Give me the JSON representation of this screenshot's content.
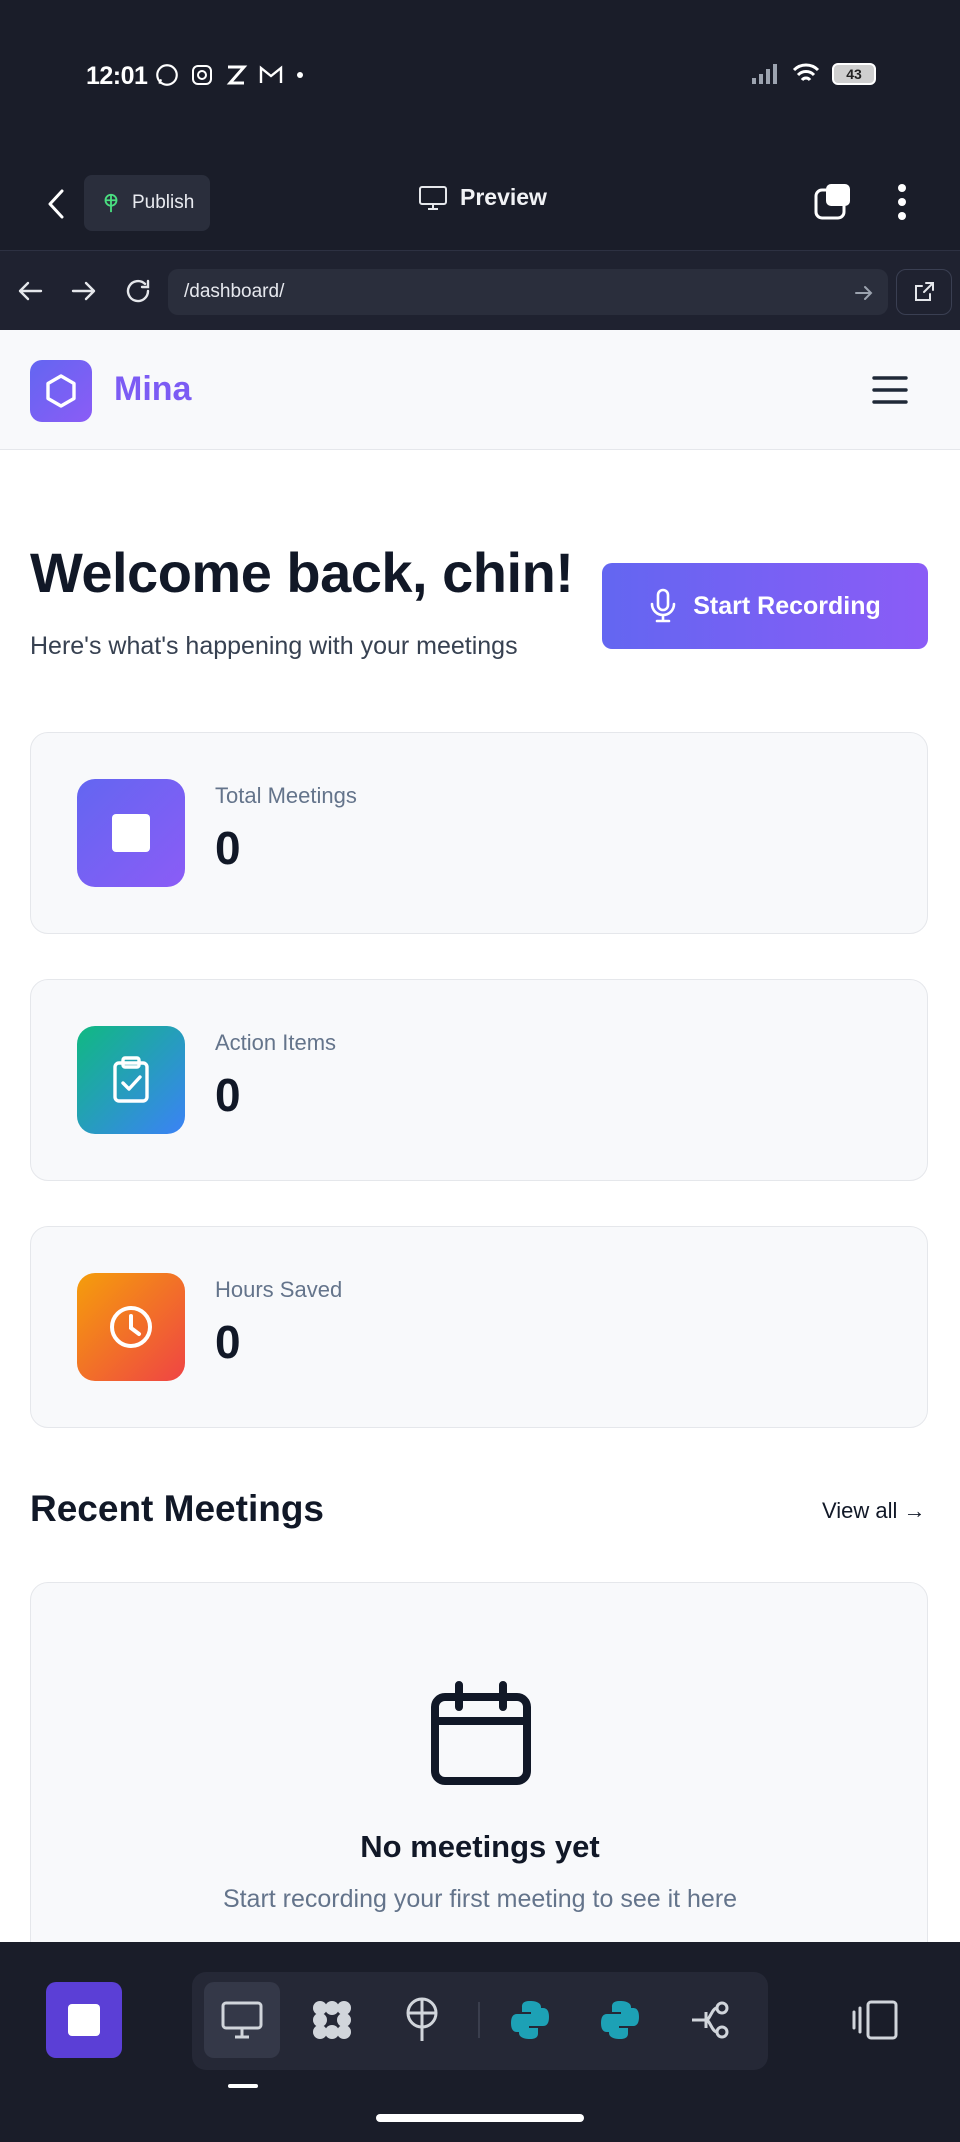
{
  "statusbar": {
    "time": "12:01",
    "battery": "43",
    "app_icons": [
      "whatsapp-icon",
      "instagram-icon",
      "z-app-icon",
      "gmail-icon",
      "dot-icon"
    ]
  },
  "appbar": {
    "publish_label": "Publish",
    "preview_label": "Preview"
  },
  "urlbar": {
    "url": "/dashboard/"
  },
  "site": {
    "brand": "Mina",
    "accent": "#7c5cf4"
  },
  "hero": {
    "title": "Welcome back, chin!",
    "subtitle": "Here's what's happening with your meetings",
    "record_label": "Start Recording"
  },
  "stats": [
    {
      "label": "Total Meetings",
      "value": "0",
      "icon": "stop-square-icon",
      "color": "#6366f1"
    },
    {
      "label": "Action Items",
      "value": "0",
      "icon": "clipboard-check-icon",
      "color": "#14b8a6"
    },
    {
      "label": "Hours Saved",
      "value": "0",
      "icon": "clock-icon",
      "color": "#f97316"
    }
  ],
  "recent": {
    "title": "Recent Meetings",
    "view_all": "View all →",
    "empty_title": "No meetings yet",
    "empty_sub": "Start recording your first meeting to see it here"
  },
  "bottom_bar": {
    "items": [
      "monitor-icon",
      "grid-icon",
      "antenna-icon",
      "python-icon",
      "python-icon",
      "branch-icon"
    ],
    "active_index": 0
  }
}
